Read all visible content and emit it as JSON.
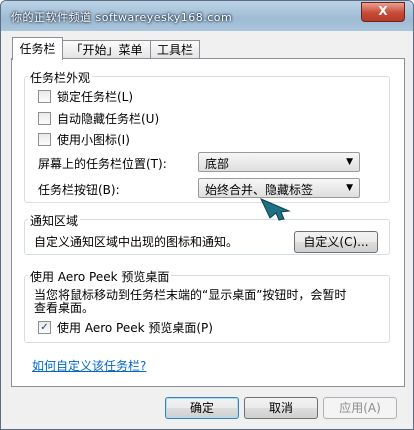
{
  "window": {
    "title": "你的正软件频道 softwareyesky168.com",
    "close_glyph": "X"
  },
  "tabs": [
    {
      "label": "任务栏"
    },
    {
      "label": "「开始」菜单"
    },
    {
      "label": "工具栏"
    }
  ],
  "appearance": {
    "title": "任务栏外观",
    "lock": {
      "label": "锁定任务栏(L)",
      "checked": false
    },
    "autohide": {
      "label": "自动隐藏任务栏(U)",
      "checked": false
    },
    "small_icons": {
      "label": "使用小图标(I)",
      "checked": false
    },
    "position": {
      "label": "屏幕上的任务栏位置(T):",
      "value": "底部"
    },
    "buttons": {
      "label": "任务栏按钮(B):",
      "value": "始终合并、隐藏标签"
    }
  },
  "notify": {
    "title": "通知区域",
    "text": "自定义通知区域中出现的图标和通知。",
    "customize_label": "自定义(C)..."
  },
  "peek": {
    "title": "使用 Aero Peek 预览桌面",
    "desc_line1": "当您将鼠标移动到任务栏末端的“显示桌面”按钮时，会暂时",
    "desc_line2": "查看桌面。",
    "checkbox": {
      "label": "使用 Aero Peek 预览桌面(P)",
      "checked": true
    }
  },
  "help_link": "如何自定义该任务栏?",
  "footer": {
    "ok": "确定",
    "cancel": "取消",
    "apply": "应用(A)"
  },
  "colors": {
    "link": "#0066cc",
    "arrow": "#1f6f86",
    "close": "#c74a36"
  }
}
